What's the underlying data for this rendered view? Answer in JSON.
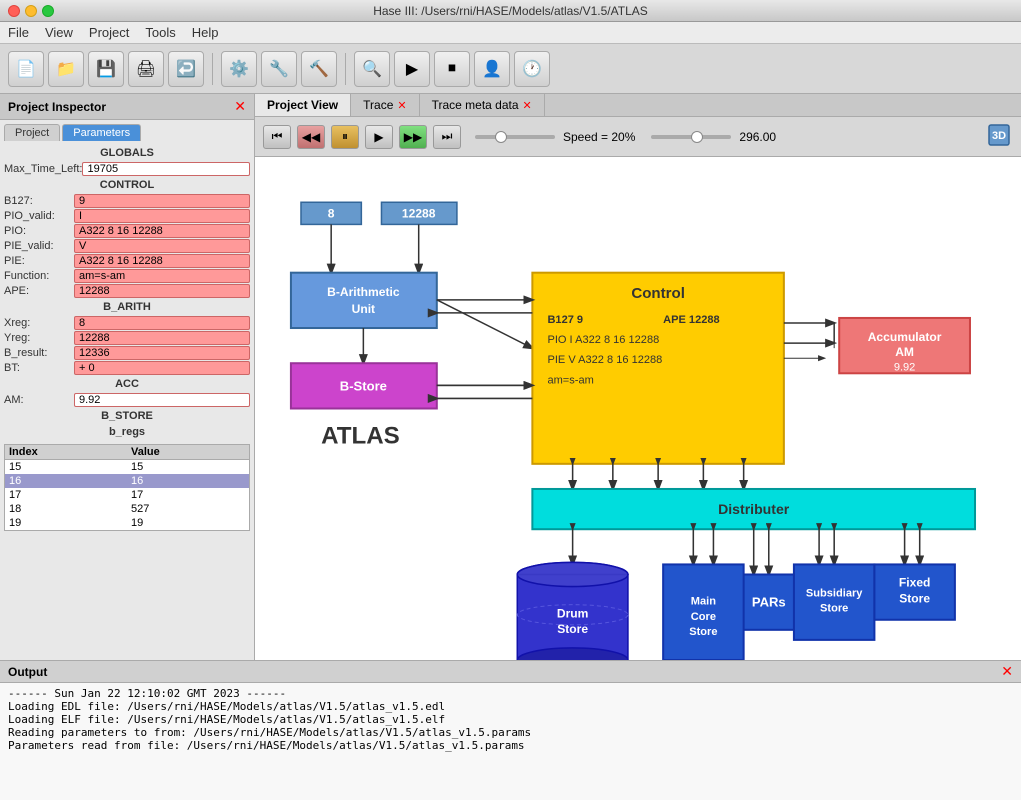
{
  "titlebar": {
    "title": "Hase III: /Users/rni/HASE/Models/atlas/V1.5/ATLAS"
  },
  "menubar": {
    "items": [
      "File",
      "View",
      "Project",
      "Tools",
      "Help"
    ]
  },
  "inspector": {
    "title": "Project Inspector",
    "tabs": [
      {
        "label": "Project",
        "active": false
      },
      {
        "label": "Parameters",
        "active": true
      }
    ],
    "globals_header": "GLOBALS",
    "max_time_label": "Max_Time_Left:",
    "max_time_value": "19705",
    "control_header": "CONTROL",
    "params": [
      {
        "label": "B127:",
        "value": "9"
      },
      {
        "label": "PIO_valid:",
        "value": "I"
      },
      {
        "label": "PIO:",
        "value": "A322 8 16 12288"
      },
      {
        "label": "PIE_valid:",
        "value": "V"
      },
      {
        "label": "PIE:",
        "value": "A322 8 16 12288"
      },
      {
        "label": "Function:",
        "value": "am=s-am"
      },
      {
        "label": "APE:",
        "value": "12288"
      }
    ],
    "b_arith_header": "B_ARITH",
    "b_arith_params": [
      {
        "label": "Xreg:",
        "value": "8"
      },
      {
        "label": "Yreg:",
        "value": "12288"
      },
      {
        "label": "B_result:",
        "value": "12336"
      },
      {
        "label": "BT:",
        "value": "+ 0"
      }
    ],
    "acc_header": "ACC",
    "am_label": "AM:",
    "am_value": "9.92",
    "b_store_header": "B_STORE",
    "b_regs_label": "b_regs",
    "table": {
      "columns": [
        "Index",
        "Value"
      ],
      "rows": [
        {
          "index": "15",
          "value": "15",
          "selected": false
        },
        {
          "index": "16",
          "value": "16",
          "selected": true
        },
        {
          "index": "17",
          "value": "17",
          "selected": false
        },
        {
          "index": "18",
          "value": "527",
          "selected": false
        },
        {
          "index": "19",
          "value": "19",
          "selected": false
        }
      ]
    }
  },
  "tabs": [
    {
      "label": "Project View",
      "closeable": false,
      "active": true
    },
    {
      "label": "Trace",
      "closeable": true,
      "active": false
    },
    {
      "label": "Trace meta data",
      "closeable": true,
      "active": false
    }
  ],
  "playback": {
    "speed_label": "Speed = 20%",
    "value": "296.00"
  },
  "diagram": {
    "atlas_label": "ATLAS",
    "control_label": "Control",
    "b127_line": "B127  9",
    "ape_line": "APE  12288",
    "pio_line": "PIO  I  A322 8 16 12288",
    "pie_line": "PIE  V  A322 8 16 12288",
    "am_line": "am=s-am",
    "b_arith_label": "B-Arithmetic\nUnit",
    "b_store_label": "B-Store",
    "accumulator_label": "Accumulator\nAM",
    "am_value": "9.92",
    "distributer_label": "Distributer",
    "drum_store_label": "Drum\nStore",
    "main_core_label": "Main\nCore\nStore",
    "subsidiary_label": "Subsidiary\nStore",
    "pars_label": "PARs",
    "fixed_store_label": "Fixed\nStore",
    "reg8_value": "8",
    "reg12288_value": "12288"
  },
  "output": {
    "title": "Output",
    "lines": [
      "------ Sun Jan 22 12:10:02 GMT 2023 ------",
      "Loading EDL file: /Users/rni/HASE/Models/atlas/V1.5/atlas_v1.5.edl",
      "Loading ELF file: /Users/rni/HASE/Models/atlas/V1.5/atlas_v1.5.elf",
      "Reading parameters to from: /Users/rni/HASE/Models/atlas/V1.5/atlas_v1.5.params",
      "Parameters read from file: /Users/rni/HASE/Models/atlas/V1.5/atlas_v1.5.params"
    ]
  }
}
